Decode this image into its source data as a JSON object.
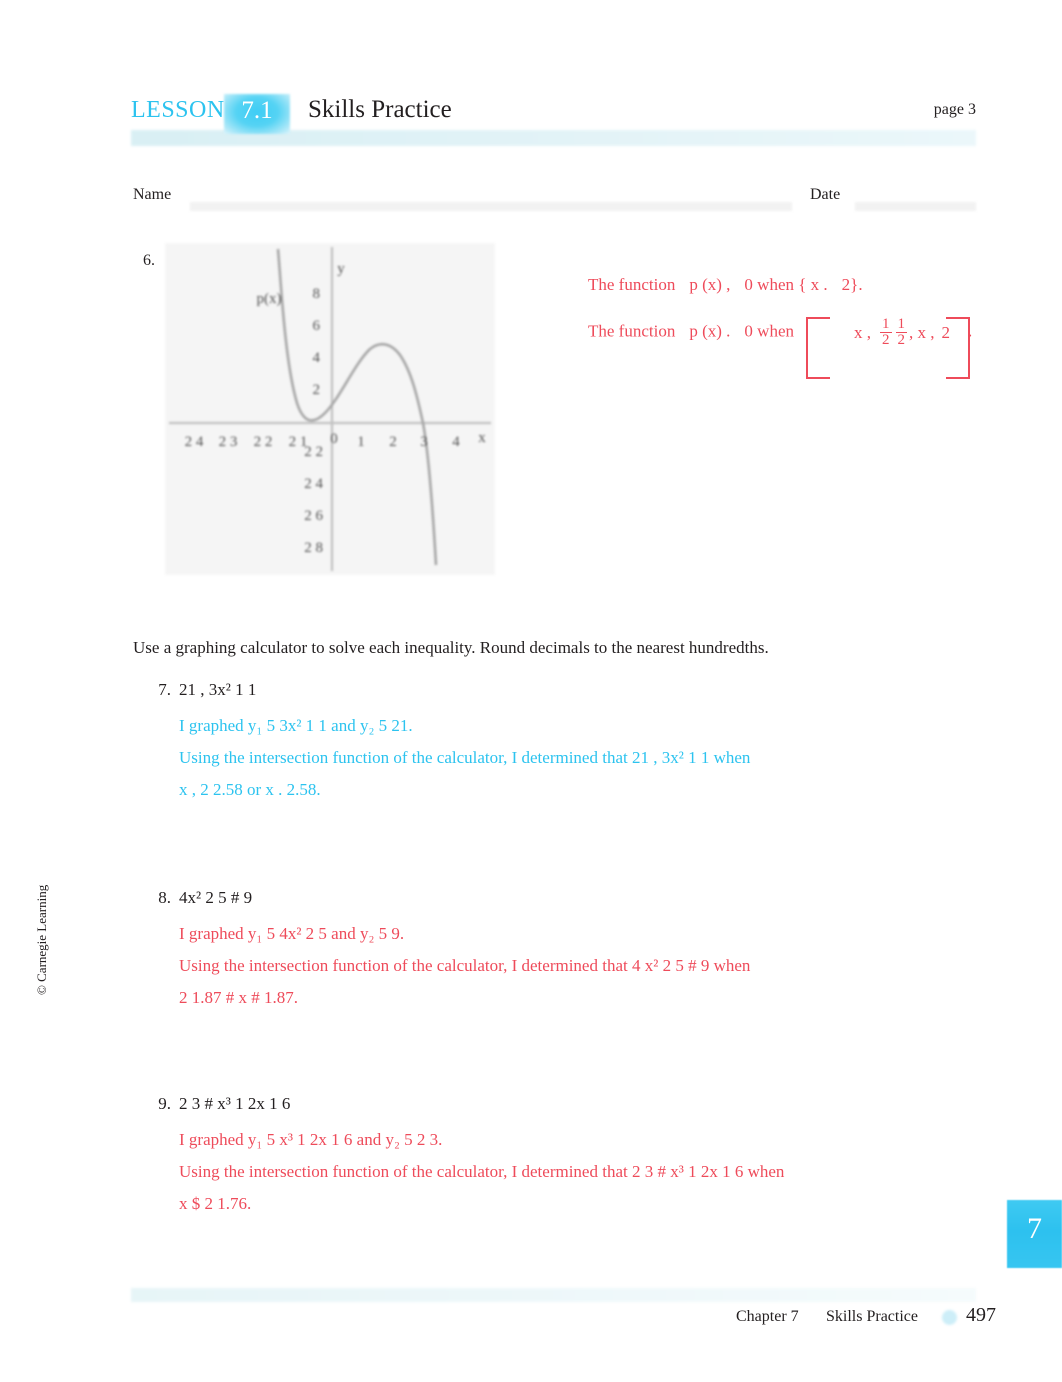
{
  "header": {
    "lesson_label": "LESSON",
    "lesson_number": "7.1",
    "title": "Skills Practice",
    "page_indicator": "page 3",
    "accent_color": "#2cc3ef"
  },
  "namedate": {
    "name_label": "Name",
    "date_label": "Date"
  },
  "question6": {
    "number": "6.",
    "graph": {
      "y_axis_label": "y",
      "x_axis_label": "x",
      "curve_label": "p(x)",
      "origin_label": "0",
      "x_ticks": [
        "2 4",
        "2 3",
        "2 2",
        "2 1",
        "1",
        "2",
        "3",
        "4"
      ],
      "y_ticks_positive": [
        "8",
        "6",
        "4",
        "2"
      ],
      "y_ticks_negative": [
        "2 2",
        "2 4",
        "2 6",
        "2 8"
      ]
    },
    "answer": {
      "color": "#ee4b5a",
      "line1": {
        "lead": "The function",
        "fn": "p (x) ,",
        "rest": "0 when { x .",
        "tail": "2}."
      },
      "line2": {
        "lead": "The function",
        "fn": "p (x) .",
        "rest": "0 when",
        "system_row_top_var": "x ,",
        "system_row_top_frac_num": "1",
        "system_row_top_frac_den": "2",
        "system_row_bottom_frac_num": "1",
        "system_row_bottom_frac_den": "2",
        "system_row_bottom_mid": ",   x ,",
        "system_row_bottom_end": "2",
        "period": "."
      }
    }
  },
  "instruction": "Use a graphing calculator to solve each inequality. Round decimals to the nearest hundredths.",
  "question7": {
    "number": "7.",
    "stem": "21 ,   3x² 1  1",
    "color": "#2cc3ef",
    "work_line1": "I graphed   y₁ 5  3x² 1  1 and  y₂ 5  21.",
    "work_line2": "Using the intersection function of the calculator, I determined that 21              ,   3x² 1  1 when",
    "work_line3": "x ,   2 2.58 or  x .   2.58."
  },
  "question8": {
    "number": "8.",
    "stem": "4x² 2  5 #  9",
    "color": "#ee4b5a",
    "work_line1": "I graphed   y₁ 5  4x² 2  5 and  y₂ 5  9.",
    "work_line2": "Using the intersection function of the calculator, I determined that 4           x² 2  5 #  9 when",
    "work_line3": "2 1.87  #  x #  1.87."
  },
  "question9": {
    "number": "9.",
    "stem": "2 3 #  x³ 1  2x 1  6",
    "color": "#ee4b5a",
    "work_line1": "I graphed   y₁ 5  x³ 1  2x 1  6 and  y₂ 5  2 3.",
    "work_line2": "Using the intersection function of the calculator, I determined that              2 3 #  x³ 1  2x 1  6 when",
    "work_line3": "x $  2 1.76."
  },
  "copyright": "© Carnegie Learning",
  "chapter_tab": {
    "number": "7"
  },
  "footer": {
    "chapter": "Chapter 7",
    "section": "Skills Practice",
    "page_number": "497"
  },
  "chart_data": {
    "type": "line",
    "title": "",
    "xlabel": "x",
    "ylabel": "y",
    "series_name": "p(x)",
    "xlim": [
      -4.6,
      4.6
    ],
    "ylim": [
      -9.2,
      9.2
    ],
    "xticks": [
      -4,
      -3,
      -2,
      -1,
      0,
      1,
      2,
      3,
      4
    ],
    "yticks": [
      -8,
      -6,
      -4,
      -2,
      2,
      4,
      6,
      8
    ],
    "grid": false,
    "legend": "none",
    "description": "Cubic-like curve p(x) descending from upper-left, crossing x-axis near x = -0.5, rising to a local maximum of about y = 5 near x = 1, then descending steeply crossing the x-axis near x = 2.4 and exiting the bottom of the grid near x = 2.7",
    "points": [
      {
        "x": -1.05,
        "y": 9.2
      },
      {
        "x": -0.95,
        "y": 7.0
      },
      {
        "x": -0.85,
        "y": 5.0
      },
      {
        "x": -0.75,
        "y": 3.2
      },
      {
        "x": -0.62,
        "y": 1.5
      },
      {
        "x": -0.5,
        "y": 0.0
      },
      {
        "x": -0.3,
        "y": 1.0
      },
      {
        "x": 0.0,
        "y": 2.4
      },
      {
        "x": 0.4,
        "y": 3.9
      },
      {
        "x": 0.8,
        "y": 4.8
      },
      {
        "x": 1.05,
        "y": 5.0
      },
      {
        "x": 1.3,
        "y": 4.8
      },
      {
        "x": 1.7,
        "y": 3.6
      },
      {
        "x": 2.0,
        "y": 2.2
      },
      {
        "x": 2.2,
        "y": 1.0
      },
      {
        "x": 2.4,
        "y": 0.0
      },
      {
        "x": 2.55,
        "y": -2.5
      },
      {
        "x": 2.68,
        "y": -5.5
      },
      {
        "x": 2.78,
        "y": -8.6
      }
    ]
  }
}
